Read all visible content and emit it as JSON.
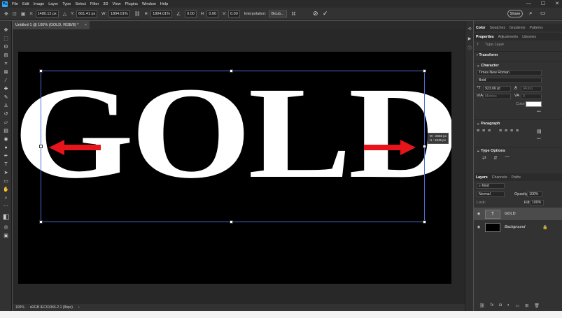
{
  "app": {
    "logo": "Ps"
  },
  "menu": [
    "File",
    "Edit",
    "Image",
    "Layer",
    "Type",
    "Select",
    "Filter",
    "3D",
    "View",
    "Plugins",
    "Window",
    "Help"
  ],
  "window_controls": {
    "minimize": "—",
    "maximize": "☐",
    "close": "✕"
  },
  "options_bar": {
    "x_label": "X:",
    "x_value": "1480.12 px",
    "y_label": "Y:",
    "y_value": "661.41 px",
    "w_label": "W:",
    "w_value": "1804.01%",
    "h_label": "H:",
    "h_value": "1804.01%",
    "angle_value": "0.00",
    "hskew_label": "H:",
    "hskew_value": "0.00",
    "vskew_label": "V:",
    "vskew_value": "0.00",
    "interp_label": "Interpolation:",
    "interp_value": "Bicub...",
    "share_label": "Share"
  },
  "document": {
    "tab_title": "Untitled-1 @ 100% (GOLD, RGB/8) *",
    "tab_close": "×",
    "text": "GOLD",
    "transform_tooltip_w": "W : 2656 px",
    "transform_tooltip_h": "H : 1045 px",
    "arrow_color": "#e8141c"
  },
  "status": {
    "zoom": "100%",
    "profile": "sRGB IEC61966-2.1 (8bpc)",
    "arrow": "›"
  },
  "panels": {
    "color_tabs": [
      "Color",
      "Swatches",
      "Gradients",
      "Patterns"
    ],
    "prop_tabs": [
      "Properties",
      "Adjustments",
      "Libraries"
    ],
    "type_layer_label": "Type Layer",
    "transform_label": "Transform",
    "character_label": "Character",
    "font_family": "Times New Roman",
    "font_style": "Bold",
    "font_size": "923.06 pt",
    "leading": "(Auto)",
    "tracking": "0",
    "metrics": "Metrics",
    "color_label": "Color",
    "paragraph_label": "Paragraph",
    "type_options_label": "Type Options",
    "more": "•••"
  },
  "layers": {
    "tabs": [
      "Layers",
      "Channels",
      "Paths"
    ],
    "kind_label": "Kind",
    "blend_mode": "Normal",
    "opacity_label": "Opacity:",
    "opacity_value": "100%",
    "lock_label": "Lock:",
    "fill_label": "Fill:",
    "fill_value": "100%",
    "items": [
      {
        "name": "GOLD",
        "thumb": "T",
        "selected": true
      },
      {
        "name": "Background",
        "thumb": "",
        "selected": false
      }
    ]
  }
}
